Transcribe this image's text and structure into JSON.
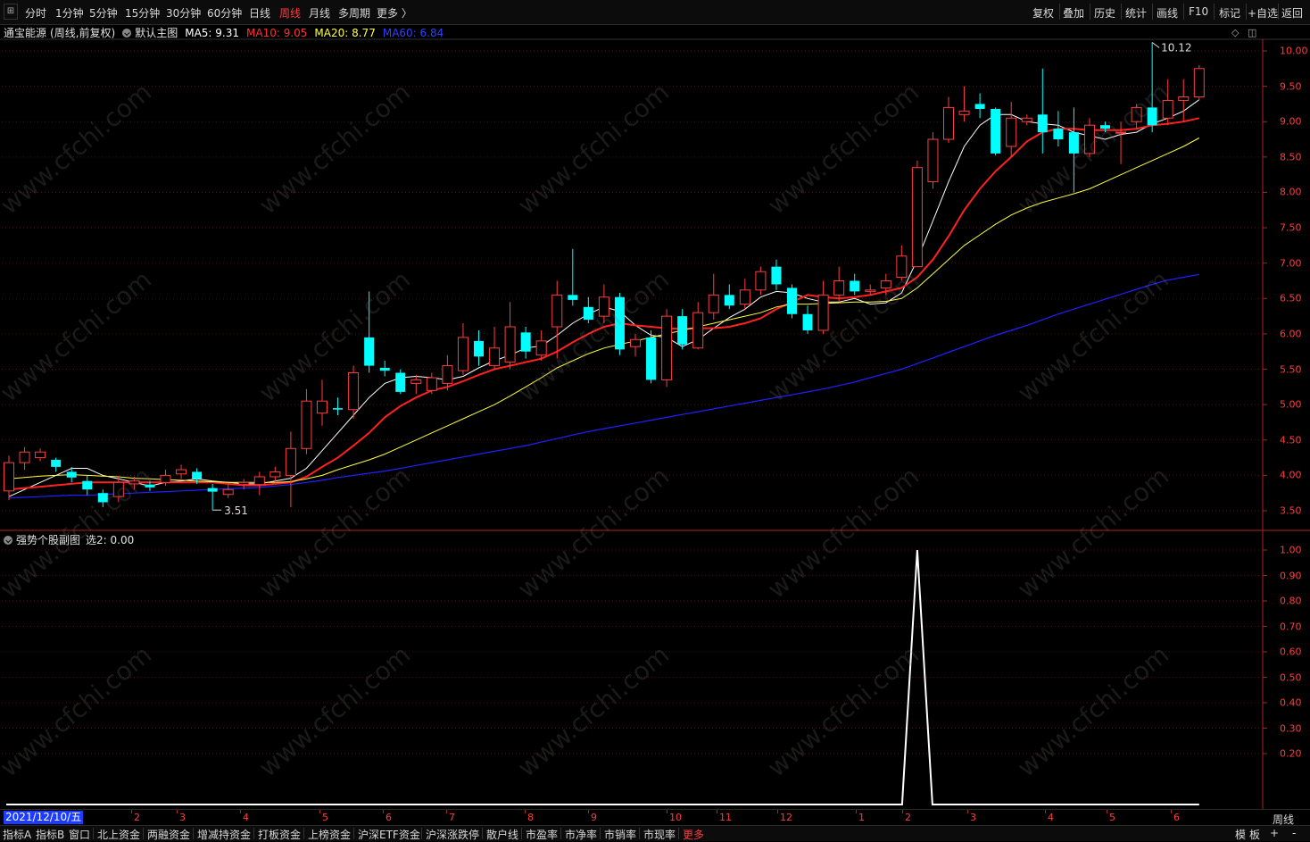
{
  "toolbar": {
    "periods": [
      "分时",
      "1分钟",
      "5分钟",
      "15分钟",
      "30分钟",
      "60分钟",
      "日线",
      "周线",
      "月线",
      "多周期",
      "更多 〉"
    ],
    "active_period": "周线",
    "right_buttons": [
      "复权",
      "叠加",
      "历史",
      "统计",
      "画线",
      "F10",
      "标记",
      "+自选",
      "返回"
    ]
  },
  "header": {
    "stock_name": "通宝能源",
    "mode": "(周线,前复权)",
    "main_chart": "默认主图",
    "ma5": "MA5: 9.31",
    "ma10": "MA10: 9.05",
    "ma20": "MA20: 8.77",
    "ma60": "MA60: 6.84"
  },
  "sub_header": {
    "indicator": "强势个股副图",
    "value": "选2: 0.00"
  },
  "colors": {
    "up": "#ff3c3c",
    "down": "#00ffff",
    "ma5": "#ffffff",
    "ma10": "#ff2020",
    "ma20": "#ffff40",
    "ma60": "#2020ff",
    "axis": "#ff3c3c"
  },
  "chart_data": [
    {
      "type": "candlestick",
      "title": "通宝能源 (周线,前复权)",
      "y_ticks": [
        "10.00",
        "9.50",
        "9.00",
        "8.50",
        "8.00",
        "7.50",
        "7.00",
        "6.50",
        "6.00",
        "5.50",
        "5.00",
        "4.50",
        "4.00",
        "3.50"
      ],
      "ylim": [
        3.3,
        10.6
      ],
      "annotations": {
        "high": "10.12",
        "low": "3.51"
      },
      "candles": [
        [
          3.78,
          4.18,
          3.65,
          4.28
        ],
        [
          4.18,
          4.33,
          4.08,
          4.4
        ],
        [
          4.25,
          4.33,
          4.2,
          4.38
        ],
        [
          4.22,
          4.12,
          4.05,
          4.25
        ],
        [
          4.05,
          3.97,
          3.9,
          4.12
        ],
        [
          3.92,
          3.8,
          3.72,
          4.0
        ],
        [
          3.75,
          3.62,
          3.55,
          3.8
        ],
        [
          3.7,
          3.9,
          3.62,
          3.98
        ],
        [
          3.88,
          3.92,
          3.8,
          3.98
        ],
        [
          3.87,
          3.83,
          3.78,
          3.92
        ],
        [
          3.9,
          4.0,
          3.85,
          4.08
        ],
        [
          4.02,
          4.08,
          3.95,
          4.15
        ],
        [
          4.05,
          3.95,
          3.88,
          4.1
        ],
        [
          3.82,
          3.77,
          3.51,
          3.88
        ],
        [
          3.73,
          3.8,
          3.68,
          3.88
        ],
        [
          3.87,
          3.9,
          3.8,
          3.95
        ],
        [
          3.87,
          3.98,
          3.72,
          4.05
        ],
        [
          3.98,
          4.05,
          3.9,
          4.12
        ],
        [
          4.0,
          4.38,
          3.55,
          4.62
        ],
        [
          4.38,
          5.05,
          4.3,
          5.22
        ],
        [
          4.88,
          5.05,
          4.7,
          5.35
        ],
        [
          4.95,
          4.93,
          4.85,
          5.1
        ],
        [
          4.93,
          5.45,
          4.8,
          5.55
        ],
        [
          5.95,
          5.55,
          5.45,
          6.6
        ],
        [
          5.52,
          5.48,
          5.4,
          5.62
        ],
        [
          5.45,
          5.18,
          5.15,
          5.5
        ],
        [
          5.3,
          5.35,
          5.15,
          5.42
        ],
        [
          5.2,
          5.38,
          5.15,
          5.45
        ],
        [
          5.3,
          5.55,
          5.2,
          5.7
        ],
        [
          5.48,
          5.95,
          5.42,
          6.15
        ],
        [
          5.9,
          5.68,
          5.55,
          6.05
        ],
        [
          5.55,
          5.8,
          5.5,
          6.1
        ],
        [
          5.6,
          6.1,
          5.5,
          6.45
        ],
        [
          6.02,
          5.75,
          5.65,
          6.1
        ],
        [
          5.7,
          5.9,
          5.62,
          6.05
        ],
        [
          6.1,
          6.55,
          5.65,
          6.75
        ],
        [
          6.55,
          6.48,
          6.4,
          7.2
        ],
        [
          6.38,
          6.2,
          6.15,
          6.52
        ],
        [
          6.25,
          6.52,
          6.15,
          6.7
        ],
        [
          6.52,
          5.78,
          5.7,
          6.58
        ],
        [
          5.82,
          5.92,
          5.68,
          6.0
        ],
        [
          5.95,
          5.35,
          5.3,
          6.05
        ],
        [
          5.35,
          6.25,
          5.25,
          6.35
        ],
        [
          6.25,
          5.85,
          5.78,
          6.35
        ],
        [
          5.8,
          6.3,
          5.78,
          6.45
        ],
        [
          6.3,
          6.55,
          6.2,
          6.85
        ],
        [
          6.55,
          6.4,
          6.35,
          6.7
        ],
        [
          6.42,
          6.62,
          6.35,
          6.78
        ],
        [
          6.62,
          6.88,
          6.55,
          6.95
        ],
        [
          6.95,
          6.7,
          6.62,
          7.05
        ],
        [
          6.65,
          6.28,
          6.22,
          6.7
        ],
        [
          6.28,
          6.05,
          6.0,
          6.4
        ],
        [
          6.05,
          6.55,
          6.0,
          6.75
        ],
        [
          6.55,
          6.75,
          6.45,
          6.95
        ],
        [
          6.75,
          6.6,
          6.55,
          6.85
        ],
        [
          6.6,
          6.62,
          6.55,
          6.7
        ],
        [
          6.65,
          6.75,
          6.55,
          6.85
        ],
        [
          6.8,
          7.1,
          6.75,
          7.25
        ],
        [
          6.95,
          8.35,
          6.95,
          8.45
        ],
        [
          8.15,
          8.75,
          8.05,
          8.85
        ],
        [
          8.75,
          9.2,
          8.7,
          9.35
        ],
        [
          9.1,
          9.15,
          9.0,
          9.5
        ],
        [
          9.25,
          9.18,
          9.05,
          9.4
        ],
        [
          9.18,
          8.55,
          8.52,
          9.2
        ],
        [
          8.65,
          9.05,
          8.5,
          9.28
        ],
        [
          9.0,
          9.05,
          8.95,
          9.1
        ],
        [
          9.1,
          8.85,
          8.55,
          9.75
        ],
        [
          8.9,
          8.75,
          8.65,
          9.15
        ],
        [
          8.85,
          8.55,
          8.0,
          9.2
        ],
        [
          8.55,
          8.95,
          8.5,
          9.05
        ],
        [
          8.95,
          8.9,
          8.85,
          9.0
        ],
        [
          8.85,
          8.85,
          8.4,
          9.0
        ],
        [
          9.0,
          9.2,
          8.9,
          9.25
        ],
        [
          9.2,
          8.95,
          8.85,
          10.12
        ],
        [
          9.05,
          9.3,
          8.95,
          9.6
        ],
        [
          9.3,
          9.35,
          9.0,
          9.6
        ],
        [
          9.35,
          9.75,
          9.3,
          9.8
        ]
      ],
      "series": [
        {
          "name": "MA5",
          "values": [
            3.7,
            3.8,
            3.9,
            4.0,
            4.1,
            4.1,
            4.0,
            3.95,
            3.9,
            3.85,
            3.9,
            3.92,
            3.95,
            3.92,
            3.9,
            3.88,
            3.88,
            3.92,
            3.96,
            4.1,
            4.35,
            4.6,
            4.85,
            5.1,
            5.3,
            5.38,
            5.4,
            5.38,
            5.35,
            5.4,
            5.52,
            5.62,
            5.7,
            5.8,
            5.83,
            5.98,
            6.15,
            6.28,
            6.38,
            6.32,
            6.12,
            5.98,
            5.95,
            5.82,
            5.92,
            6.08,
            6.23,
            6.35,
            6.52,
            6.6,
            6.58,
            6.5,
            6.45,
            6.45,
            6.5,
            6.42,
            6.44,
            6.58,
            7.05,
            7.6,
            8.15,
            8.65,
            8.95,
            9.1,
            9.1,
            9.0,
            8.97,
            8.95,
            8.85,
            8.8,
            8.75,
            8.82,
            8.85,
            8.97,
            9.05,
            9.15,
            9.31
          ]
        },
        {
          "name": "MA10",
          "values": [
            3.8,
            3.82,
            3.84,
            3.86,
            3.88,
            3.9,
            3.9,
            3.9,
            3.9,
            3.9,
            3.9,
            3.9,
            3.9,
            3.9,
            3.88,
            3.86,
            3.86,
            3.88,
            3.9,
            3.98,
            4.12,
            4.25,
            4.42,
            4.6,
            4.82,
            4.98,
            5.1,
            5.2,
            5.25,
            5.33,
            5.42,
            5.5,
            5.55,
            5.6,
            5.65,
            5.75,
            5.88,
            6.0,
            6.1,
            6.15,
            6.12,
            6.1,
            6.08,
            6.07,
            6.08,
            6.08,
            6.1,
            6.15,
            6.22,
            6.35,
            6.45,
            6.55,
            6.52,
            6.5,
            6.52,
            6.55,
            6.6,
            6.65,
            6.8,
            7.05,
            7.38,
            7.75,
            8.05,
            8.3,
            8.5,
            8.72,
            8.85,
            8.9,
            8.9,
            8.88,
            8.88,
            8.88,
            8.9,
            8.95,
            8.97,
            9.0,
            9.05
          ]
        },
        {
          "name": "MA20",
          "values": [
            3.95,
            3.97,
            3.99,
            4.0,
            4.01,
            4.0,
            3.99,
            3.98,
            3.96,
            3.95,
            3.94,
            3.93,
            3.92,
            3.91,
            3.9,
            3.9,
            3.9,
            3.9,
            3.91,
            3.95,
            4.0,
            4.08,
            4.15,
            4.22,
            4.3,
            4.4,
            4.5,
            4.6,
            4.7,
            4.8,
            4.9,
            5.0,
            5.12,
            5.25,
            5.38,
            5.52,
            5.62,
            5.72,
            5.8,
            5.85,
            5.9,
            5.95,
            6.0,
            6.05,
            6.1,
            6.15,
            6.2,
            6.25,
            6.3,
            6.38,
            6.42,
            6.42,
            6.43,
            6.44,
            6.45,
            6.45,
            6.46,
            6.5,
            6.65,
            6.85,
            7.05,
            7.25,
            7.4,
            7.55,
            7.68,
            7.78,
            7.86,
            7.92,
            7.98,
            8.05,
            8.15,
            8.25,
            8.35,
            8.45,
            8.55,
            8.65,
            8.77
          ]
        },
        {
          "name": "MA60",
          "values": [
            3.68,
            3.69,
            3.7,
            3.71,
            3.72,
            3.72,
            3.73,
            3.74,
            3.75,
            3.76,
            3.77,
            3.78,
            3.79,
            3.8,
            3.81,
            3.82,
            3.83,
            3.85,
            3.87,
            3.9,
            3.93,
            3.97,
            4.0,
            4.03,
            4.06,
            4.1,
            4.14,
            4.18,
            4.22,
            4.26,
            4.3,
            4.34,
            4.38,
            4.42,
            4.47,
            4.52,
            4.57,
            4.62,
            4.66,
            4.7,
            4.74,
            4.78,
            4.82,
            4.86,
            4.9,
            4.94,
            4.98,
            5.02,
            5.06,
            5.1,
            5.14,
            5.18,
            5.22,
            5.27,
            5.32,
            5.38,
            5.44,
            5.5,
            5.58,
            5.66,
            5.74,
            5.82,
            5.9,
            5.98,
            6.05,
            6.12,
            6.2,
            6.28,
            6.35,
            6.42,
            6.49,
            6.56,
            6.63,
            6.7,
            6.76,
            6.8,
            6.84
          ]
        }
      ]
    },
    {
      "type": "line",
      "title": "强势个股副图",
      "y_ticks": [
        "1.00",
        "0.90",
        "0.80",
        "0.70",
        "0.60",
        "0.50",
        "0.40",
        "0.30",
        "0.20"
      ],
      "ylim": [
        0,
        1.0
      ],
      "series": [
        {
          "name": "选2",
          "signal_index": 58,
          "value_at_signal": 1.0,
          "baseline": 0
        }
      ]
    }
  ],
  "date_axis": {
    "current_date": "2021/12/10/五",
    "ticks": [
      "2",
      "3",
      "4",
      "5",
      "6",
      "7",
      "8",
      "9",
      "10",
      "11",
      "12",
      "1",
      "2",
      "3",
      "4",
      "5",
      "6"
    ],
    "period_label": "周线"
  },
  "bottom_tabs": [
    "指标A",
    "指标B",
    "窗口",
    "北上资金",
    "两融资金",
    "增减持资金",
    "打板资金",
    "上榜资金",
    "沪深ETF资金",
    "沪深涨跌停",
    "散户线",
    "市盈率",
    "市净率",
    "市销率",
    "市现率",
    "更多"
  ],
  "bottom_active_tab": "更多",
  "bottom_right": [
    "模",
    "板",
    "+",
    "-"
  ],
  "watermark": "www.cfchi.com"
}
